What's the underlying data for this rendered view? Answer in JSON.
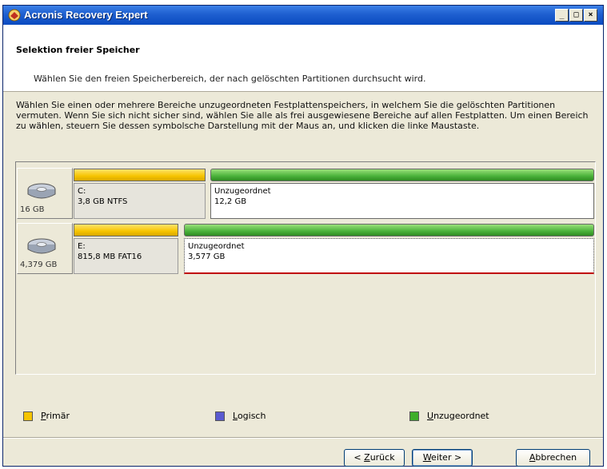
{
  "window": {
    "title": "Acronis Recovery Expert"
  },
  "header": {
    "title": "Selektion freier Speicher",
    "subtitle": "Wählen Sie den freien Speicherbereich, der nach gelöschten Partitionen durchsucht wird."
  },
  "description": "Wählen Sie einen oder mehrere Bereiche unzugeordneten Festplattenspeichers, in welchem Sie die gelöschten Partitionen vermuten. Wenn Sie sich nicht sicher sind, wählen Sie alle als frei ausgewiesene Bereiche auf allen Festplatten. Um einen Bereich zu wählen, steuern Sie dessen symbolsche Darstellung mit der Maus an, und klicken die linke Maustaste.",
  "disks": [
    {
      "size": "16 GB",
      "partitions": [
        {
          "label": "C:",
          "info": "3,8 GB  NTFS",
          "type": "primary"
        },
        {
          "label": "Unzugeordnet",
          "info": "12,2 GB",
          "type": "unallocated"
        }
      ]
    },
    {
      "size": "4,379 GB",
      "partitions": [
        {
          "label": "E:",
          "info": "815,8 MB  FAT16",
          "type": "primary"
        },
        {
          "label": "Unzugeordnet",
          "info": "3,577 GB",
          "type": "unallocated",
          "selected": true
        }
      ]
    }
  ],
  "legend": {
    "primary": {
      "first": "P",
      "rest": "rimär",
      "color": "#f6c400"
    },
    "logical": {
      "first": "L",
      "rest": "ogisch",
      "color": "#5a5ad0"
    },
    "unallocated": {
      "first": "U",
      "rest": "nzugeordnet",
      "color": "#3fae2a"
    }
  },
  "buttons": {
    "back": {
      "pre": "< ",
      "u": "Z",
      "post": "urück"
    },
    "next": {
      "u": "W",
      "post": "eiter >"
    },
    "cancel": {
      "u": "A",
      "post": "bbrechen"
    }
  }
}
